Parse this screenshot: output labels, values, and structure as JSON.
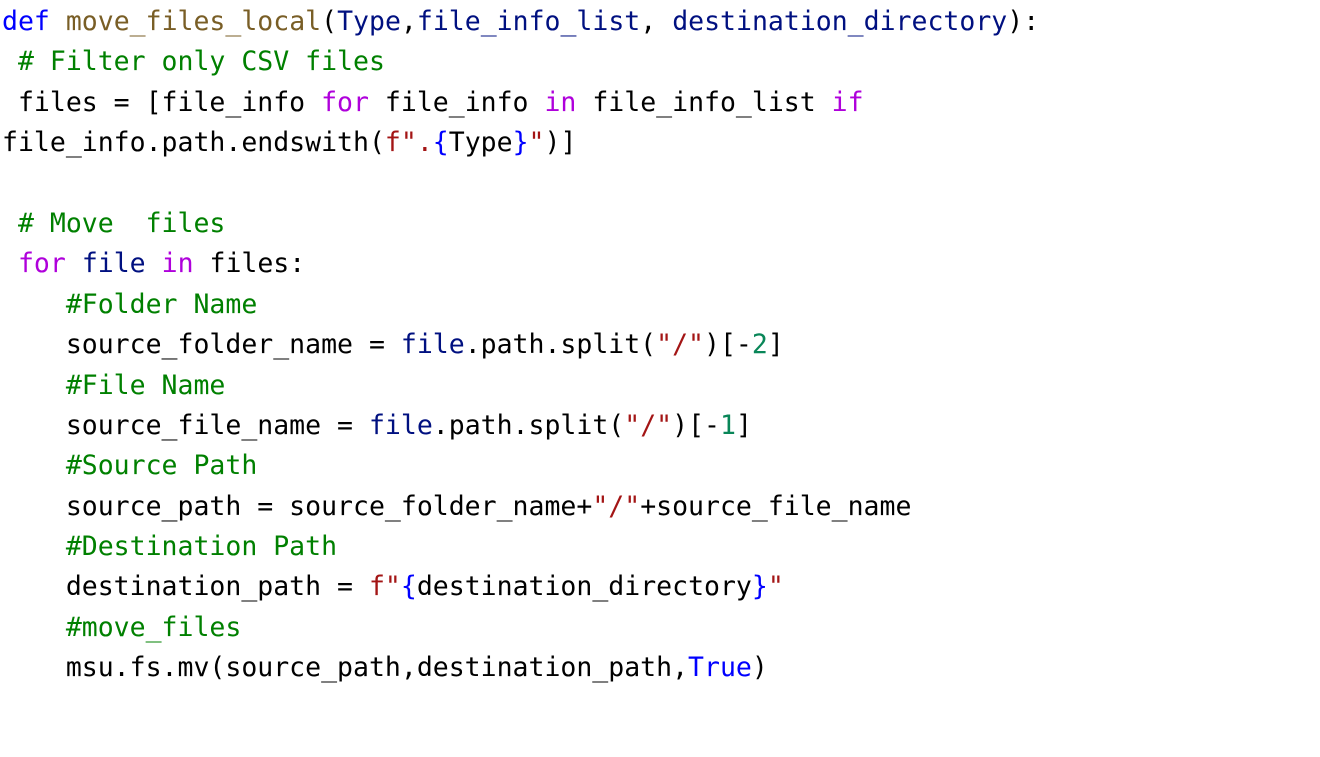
{
  "colors": {
    "plain": "#000000",
    "keyword": "#0000ff",
    "control": "#af00db",
    "function": "#795e26",
    "variable": "#001080",
    "comment": "#008000",
    "string": "#a31515",
    "number": "#098658",
    "brace": "#0000ff",
    "constant": "#0000ff"
  },
  "code": {
    "lines": [
      [
        {
          "t": "def",
          "k": "keyword"
        },
        {
          "t": " ",
          "k": "plain"
        },
        {
          "t": "move_files_local",
          "k": "function"
        },
        {
          "t": "(",
          "k": "plain"
        },
        {
          "t": "Type",
          "k": "variable"
        },
        {
          "t": ",",
          "k": "plain"
        },
        {
          "t": "file_info_list",
          "k": "variable"
        },
        {
          "t": ", ",
          "k": "plain"
        },
        {
          "t": "destination_directory",
          "k": "variable"
        },
        {
          "t": "):",
          "k": "plain"
        }
      ],
      [
        {
          "t": " # Filter only CSV files",
          "k": "comment"
        }
      ],
      [
        {
          "t": " files = [file_info ",
          "k": "plain"
        },
        {
          "t": "for",
          "k": "control"
        },
        {
          "t": " file_info ",
          "k": "plain"
        },
        {
          "t": "in",
          "k": "control"
        },
        {
          "t": " file_info_list ",
          "k": "plain"
        },
        {
          "t": "if",
          "k": "control"
        }
      ],
      [
        {
          "t": "file_info.path.endswith(",
          "k": "plain"
        },
        {
          "t": "f\".",
          "k": "string"
        },
        {
          "t": "{",
          "k": "brace"
        },
        {
          "t": "Type",
          "k": "plain"
        },
        {
          "t": "}",
          "k": "brace"
        },
        {
          "t": "\"",
          "k": "string"
        },
        {
          "t": ")]",
          "k": "plain"
        }
      ],
      [],
      [
        {
          "t": " # Move  files",
          "k": "comment"
        }
      ],
      [
        {
          "t": " ",
          "k": "plain"
        },
        {
          "t": "for",
          "k": "control"
        },
        {
          "t": " ",
          "k": "plain"
        },
        {
          "t": "file",
          "k": "variable"
        },
        {
          "t": " ",
          "k": "plain"
        },
        {
          "t": "in",
          "k": "control"
        },
        {
          "t": " files:",
          "k": "plain"
        }
      ],
      [
        {
          "t": "    #Folder Name",
          "k": "comment"
        }
      ],
      [
        {
          "t": "    source_folder_name = ",
          "k": "plain"
        },
        {
          "t": "file",
          "k": "variable"
        },
        {
          "t": ".path.split(",
          "k": "plain"
        },
        {
          "t": "\"/\"",
          "k": "string"
        },
        {
          "t": ")[-",
          "k": "plain"
        },
        {
          "t": "2",
          "k": "number"
        },
        {
          "t": "]",
          "k": "plain"
        }
      ],
      [
        {
          "t": "    #File Name",
          "k": "comment"
        }
      ],
      [
        {
          "t": "    source_file_name = ",
          "k": "plain"
        },
        {
          "t": "file",
          "k": "variable"
        },
        {
          "t": ".path.split(",
          "k": "plain"
        },
        {
          "t": "\"/\"",
          "k": "string"
        },
        {
          "t": ")[-",
          "k": "plain"
        },
        {
          "t": "1",
          "k": "number"
        },
        {
          "t": "]",
          "k": "plain"
        }
      ],
      [
        {
          "t": "    #Source Path",
          "k": "comment"
        }
      ],
      [
        {
          "t": "    source_path = source_folder_name+",
          "k": "plain"
        },
        {
          "t": "\"/\"",
          "k": "string"
        },
        {
          "t": "+source_file_name",
          "k": "plain"
        }
      ],
      [
        {
          "t": "    #Destination Path",
          "k": "comment"
        }
      ],
      [
        {
          "t": "    destination_path = ",
          "k": "plain"
        },
        {
          "t": "f\"",
          "k": "string"
        },
        {
          "t": "{",
          "k": "brace"
        },
        {
          "t": "destination_directory",
          "k": "plain"
        },
        {
          "t": "}",
          "k": "brace"
        },
        {
          "t": "\"",
          "k": "string"
        }
      ],
      [
        {
          "t": "    #move_files",
          "k": "comment"
        }
      ],
      [
        {
          "t": "    msu.fs.mv(source_path,destination_path,",
          "k": "plain"
        },
        {
          "t": "True",
          "k": "constant"
        },
        {
          "t": ")",
          "k": "plain"
        }
      ]
    ]
  }
}
